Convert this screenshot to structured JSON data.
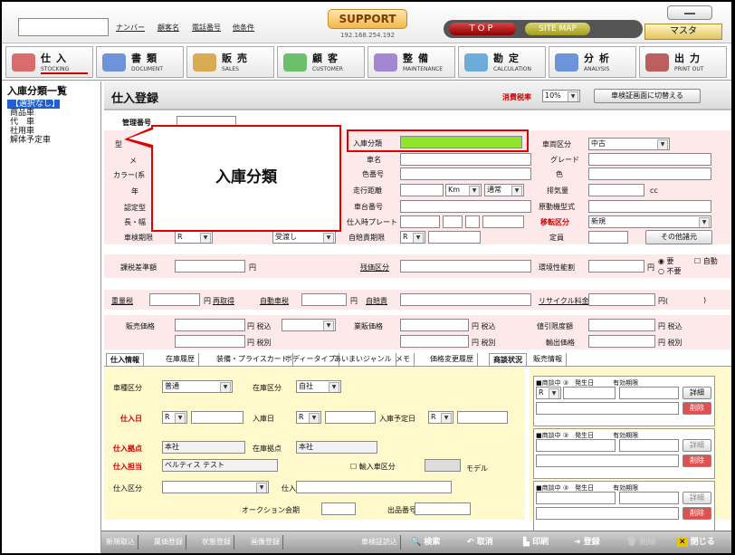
{
  "topbar": {
    "links": [
      "ナンバー",
      "顧客名",
      "電話番号",
      "他条件"
    ],
    "support_label": "SUPPORT",
    "support_ip": "192.168.254.192",
    "top_label": "TOP",
    "sitemap_label": "SITE MAP",
    "master_label": "マスタ"
  },
  "nav": [
    {
      "jp": "仕入",
      "en": "STOCKING",
      "color": "#d24b4b"
    },
    {
      "jp": "書類",
      "en": "DOCUMENT",
      "color": "#4b7bd2"
    },
    {
      "jp": "販売",
      "en": "SALES",
      "color": "#d29a2a"
    },
    {
      "jp": "顧客",
      "en": "CUSTOMER",
      "color": "#4bb04b"
    },
    {
      "jp": "整備",
      "en": "MAINTENANCE",
      "color": "#8e6cc9"
    },
    {
      "jp": "勘定",
      "en": "CALCULATION",
      "color": "#4b9ad2"
    },
    {
      "jp": "分析",
      "en": "ANALYSIS",
      "color": "#4b7bd2"
    },
    {
      "jp": "出力",
      "en": "PRINT OUT",
      "color": "#b03a3a"
    }
  ],
  "sidebar": {
    "title": "入庫分類一覧",
    "items": [
      "【選択なし】",
      "商品車",
      "代　車",
      "社用車",
      "解体予定車"
    ]
  },
  "page": {
    "title": "仕入登録",
    "tax_label": "消費税率",
    "tax_value": "10%",
    "switch_button": "車検証画面に切替える"
  },
  "form": {
    "mgmt_no": "管理番号",
    "left_labels": [
      "型",
      "メ",
      "カラー(系",
      "年",
      "認定型",
      "長・幅"
    ],
    "shaken": "車検期限",
    "shaken_val": "R",
    "receipt": "受渡し",
    "nyuko": "入庫分類",
    "shamei": "車名",
    "iro": "色番号",
    "soko": "走行距離",
    "km": "Km",
    "tsujo": "通常",
    "shadai": "車台番号",
    "shiire_plate": "仕入時プレート",
    "jibai": "自賠責期限",
    "jibai_val": "R",
    "sharyo": "車両区分",
    "sharyo_val": "中古",
    "grade": "グレード",
    "color": "色",
    "haiki": "排気量",
    "cc": "cc",
    "gendo": "原動機型式",
    "ido": "移転区分",
    "ido_val": "新規",
    "teiin": "定員",
    "other_btn": "その他諸元",
    "kazei": "課税差準額",
    "yen": "円",
    "zankin": "残価区分",
    "recycle_sec": "環境性能割",
    "yo": "要",
    "fuyo": "不要",
    "jido": "自動",
    "juryo": "重量税",
    "saishutoku": "再取得",
    "jidosha": "自動車税",
    "jibaiseki": "自賠責",
    "recycle": "リサイクル料金",
    "yen_paren": "円(",
    "paren_close": ")",
    "hanbai": "販売価格",
    "zeikomi": "税込",
    "zeibetsu": "税別",
    "gyohan": "業販価格",
    "nebiki": "値引限度額",
    "yushutsu": "輸出価格",
    "callout": "入庫分類"
  },
  "tabs": [
    "仕入情報",
    "在庫履歴",
    "装備・プライスカード",
    "ボディータイプ",
    "あいまいジャンル",
    "メモ",
    "価格変更履歴",
    "商談状況",
    "販売情報"
  ],
  "stock": {
    "sharyo": "車種区分",
    "sharyo_val": "普通",
    "zaiko": "在庫区分",
    "zaiko_val": "自社",
    "shiire_bi": "仕入日",
    "shiire_val": "R",
    "nyuko_bi": "入庫日",
    "nyuko_val": "R",
    "nyuko_yotei": "入庫予定日",
    "nyuko_yotei_val": "R",
    "kyoten": "仕入拠点",
    "kyoten_val": "本社",
    "zaiko_kyoten": "在庫拠点",
    "zaiko_kyoten_val": "本社",
    "tanto": "仕入担当",
    "tanto_val": "ベルティス テスト",
    "yunyu": "輸入車区分",
    "model": "モデル",
    "kubun": "仕入区分",
    "saki": "仕入先",
    "auction": "オークション会期",
    "shupin": "出品番号"
  },
  "negotiation": {
    "header": "■商談中 ③　発生日　　　有効期限",
    "detail": "詳細",
    "delete": "削除",
    "r_val": "R"
  },
  "bottom": {
    "left": [
      "新規取込",
      "属価登録",
      "状態登録",
      "画像登録"
    ],
    "right": [
      "車検証読込",
      "検索",
      "取消",
      "印刷",
      "登録",
      "削除",
      "閉じる"
    ]
  }
}
